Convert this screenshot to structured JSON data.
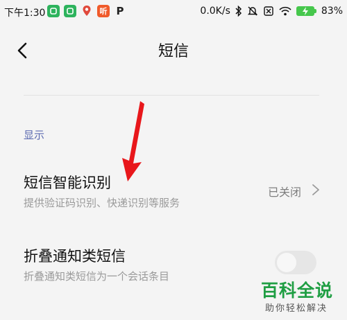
{
  "status_bar": {
    "time": "下午1:30",
    "apps": [
      {
        "name": "green-app-icon",
        "color": "#2db35d",
        "glyph": "◘"
      },
      {
        "name": "green-app-icon-2",
        "color": "#2db35d",
        "glyph": "◘"
      },
      {
        "name": "location-pin-icon",
        "color": "#e0493c",
        "glyph": ""
      },
      {
        "name": "ting-app-icon",
        "color": "#f05a2a",
        "glyph": "听"
      },
      {
        "name": "p-app-icon",
        "color": "#222222",
        "glyph": "P"
      }
    ],
    "net_speed": "0.0K/s",
    "battery": "83%"
  },
  "header": {
    "title": "短信"
  },
  "section": {
    "label": "显示"
  },
  "settings": [
    {
      "title": "短信智能识别",
      "subtitle": "提供验证码识别、快递识别等服务",
      "value": "已关闭"
    },
    {
      "title": "折叠通知类短信",
      "subtitle": "折叠通知类短信为一个会话条目",
      "toggle_on": false
    }
  ],
  "colors": {
    "section_label": "#5b6ab0",
    "arrow": "#e8171b",
    "watermark": "#1f9e43"
  },
  "watermark": {
    "main": "百科全说",
    "sub": "助你轻松解决"
  }
}
